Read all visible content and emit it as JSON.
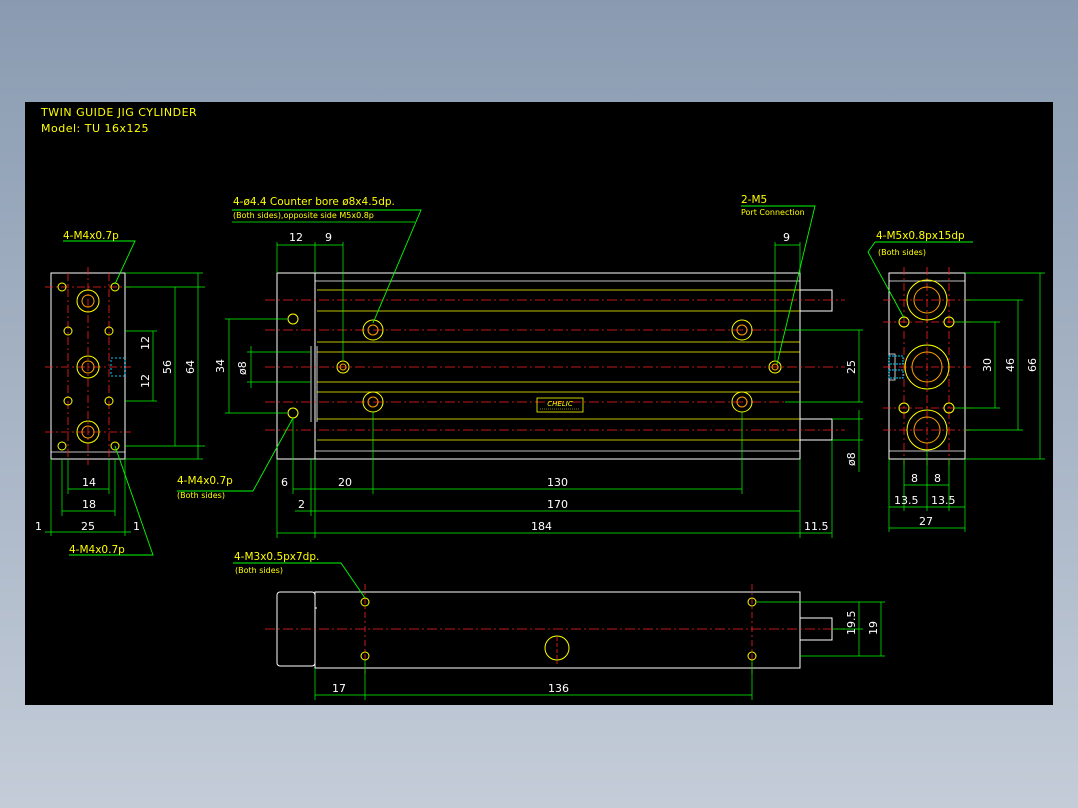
{
  "title": {
    "line1": "TWIN GUIDE JIG CYLINDER",
    "line2": "Model:  TU 16x125"
  },
  "brand_label": "CHELIC",
  "notes": {
    "left_top": "4-M4x0.7p",
    "left_bottom": "4-M4x0.7p",
    "front_mount": "4-M4x0.7p",
    "front_mount_sub": "(Both sides)",
    "counter_bore": "4-ø4.4 Counter bore ø8x4.5dp.",
    "counter_bore_sub": "(Both sides),opposite side M5x0.8p",
    "port": "2-M5",
    "port_sub": "Port Connection",
    "right_thread": "4-M5x0.8px15dp",
    "right_thread_sub": "(Both sides)",
    "bottom_thread": "4-M3x0.5px7dp.",
    "bottom_thread_sub": "(Both sides)"
  },
  "dimensions": {
    "left_14": "14",
    "left_18": "18",
    "left_25": "25",
    "left_1a": "1",
    "left_1b": "1",
    "left_12a": "12",
    "left_12b": "12",
    "left_56": "56",
    "left_64": "64",
    "front_12": "12",
    "front_9": "9",
    "front_34": "34",
    "front_ø8": "ø8",
    "front_6": "6",
    "front_20": "20",
    "front_130": "130",
    "front_2": "2",
    "front_170": "170",
    "front_184": "184",
    "front_11_5": "11.5",
    "front_9r": "9",
    "front_25": "25",
    "front_ø8r": "ø8",
    "right_30": "30",
    "right_46": "46",
    "right_66": "66",
    "right_8a": "8",
    "right_8b": "8",
    "right_13_5a": "13.5",
    "right_13_5b": "13.5",
    "right_27": "27",
    "bottom_17": "17",
    "bottom_136": "136",
    "bottom_19_5": "19.5",
    "bottom_19": "19"
  },
  "colors": {
    "background": "#000000",
    "outline": "#ffffff",
    "dimension": "#00ff00",
    "centerline": "#ff0000",
    "hole": "#ffff00",
    "port": "#00ccff"
  }
}
